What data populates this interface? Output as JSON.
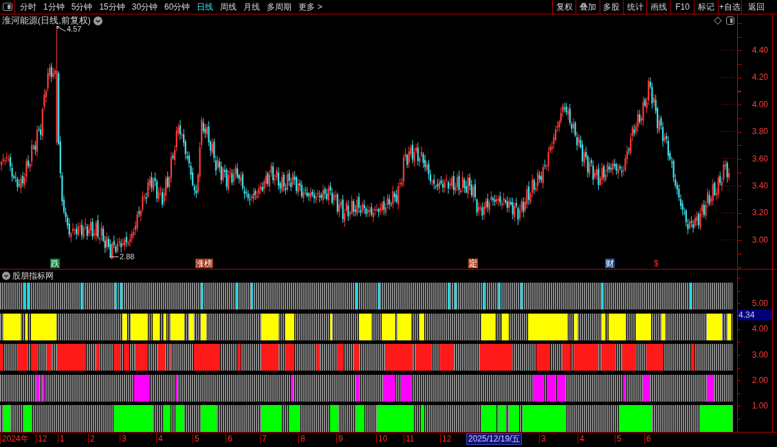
{
  "toolbar": {
    "periods": [
      {
        "label": "分时",
        "selected": false
      },
      {
        "label": "1分钟",
        "selected": false
      },
      {
        "label": "5分钟",
        "selected": false
      },
      {
        "label": "15分钟",
        "selected": false
      },
      {
        "label": "30分钟",
        "selected": false
      },
      {
        "label": "60分钟",
        "selected": false
      },
      {
        "label": "日线",
        "selected": true
      },
      {
        "label": "周线",
        "selected": false
      },
      {
        "label": "月线",
        "selected": false
      },
      {
        "label": "多周期",
        "selected": false
      }
    ],
    "more": "更多 >",
    "actions": [
      "复权",
      "叠加",
      "多股",
      "统计",
      "画线",
      "F10",
      "标记",
      "+自选",
      "返回"
    ]
  },
  "price_chart": {
    "title": "淮河能源(日线,前复权)",
    "high_label": "4.57",
    "low_label": "2.88",
    "events": [
      {
        "kind": "tag",
        "text": "跌",
        "color": "#0b7d3a"
      },
      {
        "kind": "tag",
        "text": "涨榜",
        "color": "#9c2f12"
      },
      {
        "kind": "tag",
        "text": "定",
        "color": "#c8461a"
      },
      {
        "kind": "tag",
        "text": "财",
        "color": "#1d4f8f"
      },
      {
        "kind": "symbol",
        "text": "$",
        "color": "#ff2a2a"
      }
    ],
    "axis_labels": [
      "4.40",
      "4.20",
      "4.00",
      "3.80",
      "3.60",
      "3.40",
      "3.20",
      "3.00"
    ]
  },
  "indicator": {
    "title": "股朋指标网",
    "rows": [
      {
        "color": "#22d8e8"
      },
      {
        "color": "#ffff00"
      },
      {
        "color": "#ff1a1a"
      },
      {
        "color": "#ff00ff"
      },
      {
        "color": "#00ff00"
      }
    ],
    "axis_labels": [
      "5.00",
      "4.00",
      "3.00",
      "2.00",
      "1.00"
    ],
    "cursor_value": "4.34"
  },
  "time_axis": {
    "labels": [
      "2024年",
      "12",
      "1",
      "2",
      "3",
      "4",
      "5",
      "6",
      "7",
      "8",
      "9",
      "10",
      "11",
      "12",
      "3",
      "4",
      "5",
      "6"
    ],
    "cursor_date": "2025/12/19/五"
  }
}
